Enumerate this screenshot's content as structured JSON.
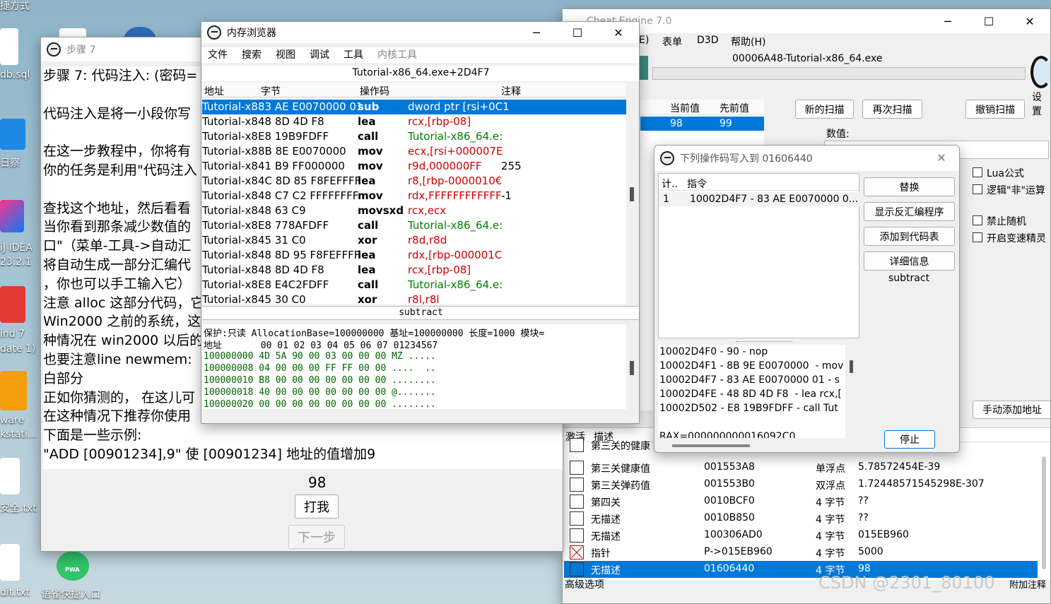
{
  "desktop": {
    "icons": [
      "捷方式",
      "db.sql",
      "日察",
      "iJ IDEA",
      "23.2.1",
      "ind 7",
      "date 1)",
      "ware",
      "kstati...",
      "安全.txt",
      "dit.txt",
      "语雀快捷入口"
    ],
    "pwa_badge": "PWA",
    "watermark": "CSDN @2301_80100"
  },
  "tutorial": {
    "title": "步骤 7",
    "lines": [
      "步骤 7: 代码注入: (密码=",
      "",
      "代码注入是将一小段你写",
      "",
      "在这一步教程中，你将有",
      "你的任务是利用\"代码注入",
      "",
      "查找这个地址，然后看看",
      "当你看到那条减少数值的",
      "口\"（菜单-工具->自动汇",
      "将自动生成一部分汇编代",
      "，你也可以手工输入它）",
      "注意 alloc 这部分代码，它",
      "Win2000 之前的系统，这",
      "种情况在 win2000 以后的",
      "也要注意line newmem: ",
      "白部分",
      "正如你猜测的， 在这儿可",
      "在这种情况下推荐你使用",
      "下面是一些示例:",
      "\"ADD [00901234],9\" 使 [00901234] 地址的值增加9"
    ],
    "value": "98",
    "hit_button": "打我",
    "next_button": "下一步"
  },
  "ce": {
    "title": "Cheat Engine 7.0",
    "menu": [
      "E)",
      "表单",
      "D3D",
      "帮助(H)"
    ],
    "process": "00006A48-Tutorial-x86_64.exe",
    "settings": "设置",
    "scan_columns": [
      "当前值",
      "先前值"
    ],
    "scan_row": [
      "98",
      "99"
    ],
    "new_scan": "新的扫描",
    "next_scan": "再次扫描",
    "undo_scan": "撤销扫描",
    "value_label": "数值:",
    "options": [
      "Lua公式",
      "逻辑\"非\"运算",
      "禁止随机",
      "开启变速精灵"
    ],
    "manual_add": "手动添加地址",
    "list_headers": [
      "激活",
      "描述"
    ],
    "advanced": "高级选项",
    "append": "附加注释",
    "list": [
      {
        "desc": "第三关的健康",
        "addr": "",
        "type": "",
        "val": ""
      },
      {
        "desc": "第三关健康值",
        "addr": "001553A8",
        "type": "单浮点",
        "val": "5.78572454E-39"
      },
      {
        "desc": "第三关弹药值",
        "addr": "001553B0",
        "type": "双浮点",
        "val": "1.72448571545298E-307"
      },
      {
        "desc": "第四关",
        "addr": "0010BCF0",
        "type": "4 字节",
        "val": "??"
      },
      {
        "desc": "无描述",
        "addr": "0010B850",
        "type": "4 字节",
        "val": "??"
      },
      {
        "desc": "无描述",
        "addr": "100306AD0",
        "type": "4 字节",
        "val": "015EB960"
      },
      {
        "desc": "指针",
        "addr": "P->015EB960",
        "type": "4 字节",
        "val": "5000"
      },
      {
        "desc": "无描述",
        "addr": "01606440",
        "type": "4 字节",
        "val": "98"
      }
    ]
  },
  "membrowser": {
    "title": "内存浏览器",
    "menu": [
      "文件",
      "搜索",
      "视图",
      "调试",
      "工具",
      "内核工具"
    ],
    "location": "Tutorial-x86_64.exe+2D4F7",
    "cols": [
      "地址",
      "字节",
      "操作码",
      "注释"
    ],
    "rows": [
      {
        "addr": "Tutorial-x883 AE E0070000 01",
        "op": "sub",
        "args": "dword ptr [rsi+0C1",
        "cmt": ""
      },
      {
        "addr": "Tutorial-x848 8D 4D F8",
        "op": "lea",
        "args": "rcx,[rbp-08]",
        "cmt": ""
      },
      {
        "addr": "Tutorial-x8E8 19B9FDFF",
        "op": "call",
        "args": "Tutorial-x86_64.e:",
        "cmt": ""
      },
      {
        "addr": "Tutorial-x88B 8E E0070000",
        "op": "mov",
        "args": "ecx,[rsi+000007E",
        "cmt": ""
      },
      {
        "addr": "Tutorial-x841 B9 FF000000",
        "op": "mov",
        "args": "r9d,000000FF",
        "cmt": "255"
      },
      {
        "addr": "Tutorial-x84C 8D 85 F8FEFFFF",
        "op": "lea",
        "args": "r8,[rbp-0000010€",
        "cmt": ""
      },
      {
        "addr": "Tutorial-x848 C7 C2 FFFFFFFF",
        "op": "mov",
        "args": "rdx,FFFFFFFFFFFF",
        "cmt": "-1"
      },
      {
        "addr": "Tutorial-x848 63 C9",
        "op": "movsxd",
        "args": "rcx,ecx",
        "cmt": ""
      },
      {
        "addr": "Tutorial-x8E8 778AFDFF",
        "op": "call",
        "args": "Tutorial-x86_64.e:",
        "cmt": ""
      },
      {
        "addr": "Tutorial-x845 31 C0",
        "op": "xor",
        "args": "r8d,r8d",
        "cmt": ""
      },
      {
        "addr": "Tutorial-x848 8D 95 F8FEFFFF",
        "op": "lea",
        "args": "rdx,[rbp-000001C",
        "cmt": ""
      },
      {
        "addr": "Tutorial-x848 8D 4D F8",
        "op": "lea",
        "args": "rcx,[rbp-08]",
        "cmt": ""
      },
      {
        "addr": "Tutorial-x8E8 E4C2FDFF",
        "op": "call",
        "args": "Tutorial-x86_64.e:",
        "cmt": ""
      },
      {
        "addr": "Tutorial-x845 30 C0",
        "op": "xor",
        "args": "r8l,r8l",
        "cmt": ""
      }
    ],
    "status": "subtract",
    "info": "保护:只读  AllocationBase=100000000 基址=100000000 长度=1000 模块=",
    "hex_header": "地址       00 01 02 03 04 05 06 07 01234567",
    "hex_rows": [
      "100000000 4D 5A 90 00 03 00 00 00 MZ .....",
      "100000008 04 00 00 00 FF FF 00 00 ....  ..",
      "100000010 B8 00 00 00 00 00 00 00 ........",
      "100000018 40 00 00 00 00 00 00 00 @.......",
      "100000020 00 00 00 00 00 00 00 00 ........"
    ]
  },
  "opcodes": {
    "title": "下列操作码写入到 01606440",
    "headers": [
      "计..",
      "指令"
    ],
    "row": [
      "1",
      "10002D4F7 - 83 AE E0070000 0..."
    ],
    "buttons": [
      "替换",
      "显示反汇编程序",
      "添加到代码表",
      "详细信息"
    ],
    "info": "subtract",
    "disasm": [
      "10002D4F0 - 90 - nop",
      "10002D4F1 - 8B 9E E0070000  - mov",
      "10002D4F7 - 83 AE E0070000 01 - s",
      "10002D4FE - 48 8D 4D F8  - lea rcx,[",
      "10002D502 - E8 19B9FDFF - call Tut",
      "",
      "RAX=000000000016092C0"
    ],
    "stop": "停止"
  }
}
